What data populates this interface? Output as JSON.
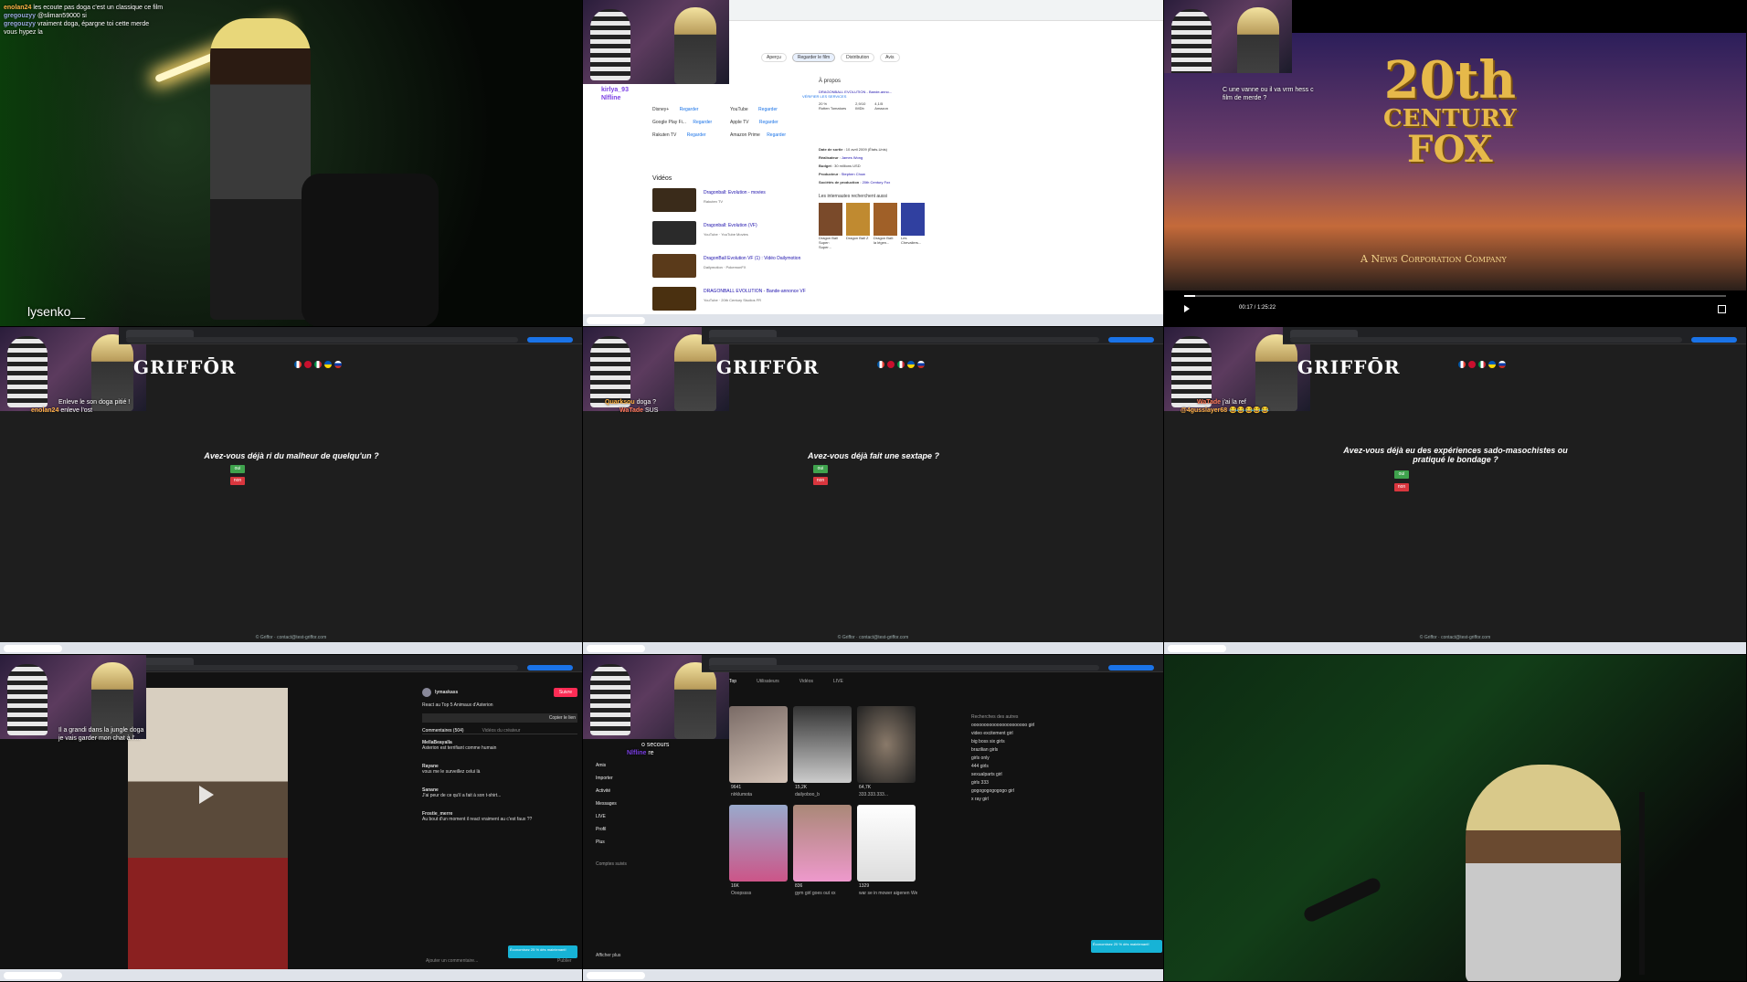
{
  "cells": {
    "c1": {
      "streamer_label": "lysenko__",
      "chat": [
        {
          "user": "enolan24",
          "msg": "les ecoute pas doga c'est un classique ce film"
        },
        {
          "user": "gregouzyy",
          "msg": "@sliman59000 si"
        },
        {
          "user": "gregouzyy",
          "msg": "vraiment doga, épargne toi cette merde"
        },
        {
          "user": "",
          "msg": "vous hypez la"
        }
      ]
    },
    "c2": {
      "tabs": [
        "Aperçu",
        "Regarder le film",
        "Distribution",
        "Avis"
      ],
      "chat": [
        {
          "user": "kirlya_93",
          "msg": ""
        },
        {
          "user": "Nlfline",
          "msg": ""
        }
      ],
      "services": [
        {
          "name": "Disney+",
          "action": "Regarder"
        },
        {
          "name": "YouTube",
          "action": "Regarder"
        },
        {
          "name": "Google Play Fi...",
          "action": "Regarder"
        },
        {
          "name": "Apple TV",
          "action": "Regarder"
        },
        {
          "name": "Rakuten TV",
          "action": "Regarder"
        },
        {
          "name": "Amazon Prime",
          "action": "Regarder"
        }
      ],
      "verify_link": "VÉRIFIER LES SERVICES",
      "videos_heading": "Vidéos",
      "videos": [
        {
          "title": "Dragonball: Evolution - movies",
          "source": "Rakuten TV"
        },
        {
          "title": "Dragonball: Evolution (VF)",
          "source": "YouTube · YouTube Movies"
        },
        {
          "title": "DragonBall Evolution VF (1) : Vidéo Dailymotion",
          "source": "Dailymotion · PokemonFX"
        },
        {
          "title": "DRAGONBALL EVOLUTION - Bande-annonce VF",
          "source": "YouTube · 20th Century Studios FR"
        }
      ],
      "about_heading": "À propos",
      "about_title": "DRAGONBALL EVOLUTION - Bande-anno...",
      "ratings": [
        {
          "value": "20 %",
          "source": "Rotten Tomatoes"
        },
        {
          "value": "2,9/10",
          "source": "IMDb"
        },
        {
          "value": "4,1/5",
          "source": "Amazon"
        }
      ],
      "details": [
        {
          "k": "Date de sortie",
          "v": "10 avril 2009 (États-Unis)"
        },
        {
          "k": "Réalisateur",
          "v": "James Wong"
        },
        {
          "k": "Budget",
          "v": "30 millions USD"
        },
        {
          "k": "Producteur",
          "v": "Stephen Chow"
        },
        {
          "k": "Sociétés de production",
          "v": "20th Century Fox"
        }
      ],
      "also_search": "Les internautes recherchent aussi",
      "also_items": [
        "Dragon Ball Super: Super...",
        "Dragon Ball Z",
        "Dragon Ball: la légen...",
        "Les Chevaliers..."
      ]
    },
    "c3": {
      "chat": [
        {
          "user": "",
          "msg": "C une vanne ou il va vrm hess c film de merde ?"
        }
      ],
      "logo_line1": "20th",
      "logo_line2": "CENTURY",
      "logo_line3": "FOX",
      "tagline": "A News Corporation Company",
      "time": "00:17 / 1:25:22"
    },
    "c4": {
      "logo": "GRIFFŌR",
      "chat": [
        {
          "user": "",
          "msg": "Enleve le son doga pitié !"
        },
        {
          "user": "enolan24",
          "msg": "enleve l'ost"
        }
      ],
      "question": "Avez-vous déjà ri du malheur de quelqu'un ?",
      "yes": "oui",
      "no": "non",
      "footer": "© Griffor · contact@test-griffor.com"
    },
    "c5": {
      "logo": "GRIFFŌR",
      "chat": [
        {
          "user": "Quarksou",
          "msg": "doga ?"
        },
        {
          "user": "WaTade",
          "msg": "SUS"
        }
      ],
      "question": "Avez-vous déjà fait une sextape ?",
      "yes": "oui",
      "no": "non",
      "footer": "© Griffor · contact@test-griffor.com"
    },
    "c6": {
      "logo": "GRIFFŌR",
      "chat": [
        {
          "user": "WaTade",
          "msg": "j'ai la ref"
        },
        {
          "user": "@4gusslayer68",
          "msg": "😂😂😂😂😂"
        }
      ],
      "question_line1": "Avez-vous déjà eu des expériences sado-masochistes ou",
      "question_line2": "pratiqué le bondage ?",
      "yes": "oui",
      "no": "non",
      "footer": "© Griffor · contact@test-griffor.com"
    },
    "c7": {
      "chat": [
        {
          "user": "",
          "msg": "Il a grandi dans la jungle doga"
        },
        {
          "user": "",
          "msg": "je vais garder mon chat à l'..."
        }
      ],
      "author": "lymaskass",
      "follow": "Suivre",
      "caption": "React au Top 5 Animaux d'Asterion",
      "comments_tab": "Commentaires (504)",
      "creator_tab": "Vidéos du créateur",
      "copy_link": "Copier le lien",
      "comments": [
        {
          "user": "MellaBeayalla",
          "text": "Asterion est terrifiant comme humain"
        },
        {
          "user": "Rayane",
          "text": "vous me le surveillez celui là"
        },
        {
          "user": "Sanane",
          "text": "J'ai peur de ce qu'il a fait à son t-shirt..."
        },
        {
          "user": "Frostie_merre",
          "text": "Au bout d'un moment il react vraiment au c'est faux ??"
        }
      ],
      "add_comment": "Ajouter un commentaire...",
      "post": "Publier",
      "promo": "Économisez 25 % dès maintenant!"
    },
    "c8": {
      "chat": [
        {
          "user": "",
          "msg": "o secours"
        },
        {
          "user": "Nlfline",
          "msg": "re"
        }
      ],
      "tabs": [
        "Top",
        "Utilisateurs",
        "Vidéos",
        "LIVE"
      ],
      "sidebar": [
        "Amis",
        "Importer",
        "Activité",
        "Messages",
        "LIVE",
        "Profil",
        "Plus"
      ],
      "following_heading": "Comptes suivis",
      "show_more": "Afficher plus",
      "results": [
        {
          "user": "nlrklumota",
          "likes": "9641"
        },
        {
          "user": "dailyoboo_b",
          "likes": "15,2K"
        },
        {
          "user": "333.333.333...",
          "likes": "64,7K"
        },
        {
          "user": "Ooopssss",
          "likes": "16K"
        },
        {
          "user": "gym girl goes out xx",
          "likes": "836"
        },
        {
          "user": "war se in mower aigenen We...",
          "likes": "1329"
        }
      ],
      "related_heading": "Recherches des autres",
      "related": [
        "oooooooooooooooooooooo girl",
        "video excitement girl",
        "big boss six girls",
        "brazilian girls",
        "girls only",
        "444 girls",
        "sexualparts girl",
        "girls 333",
        "gogogogogogogo girl",
        "x ray girl"
      ],
      "promo": "Économisez 25 % dès maintenant!"
    },
    "c9": {}
  },
  "colors": {
    "oui": "#3fa34d",
    "non": "#d9363e",
    "accent": "#1a73e8"
  }
}
